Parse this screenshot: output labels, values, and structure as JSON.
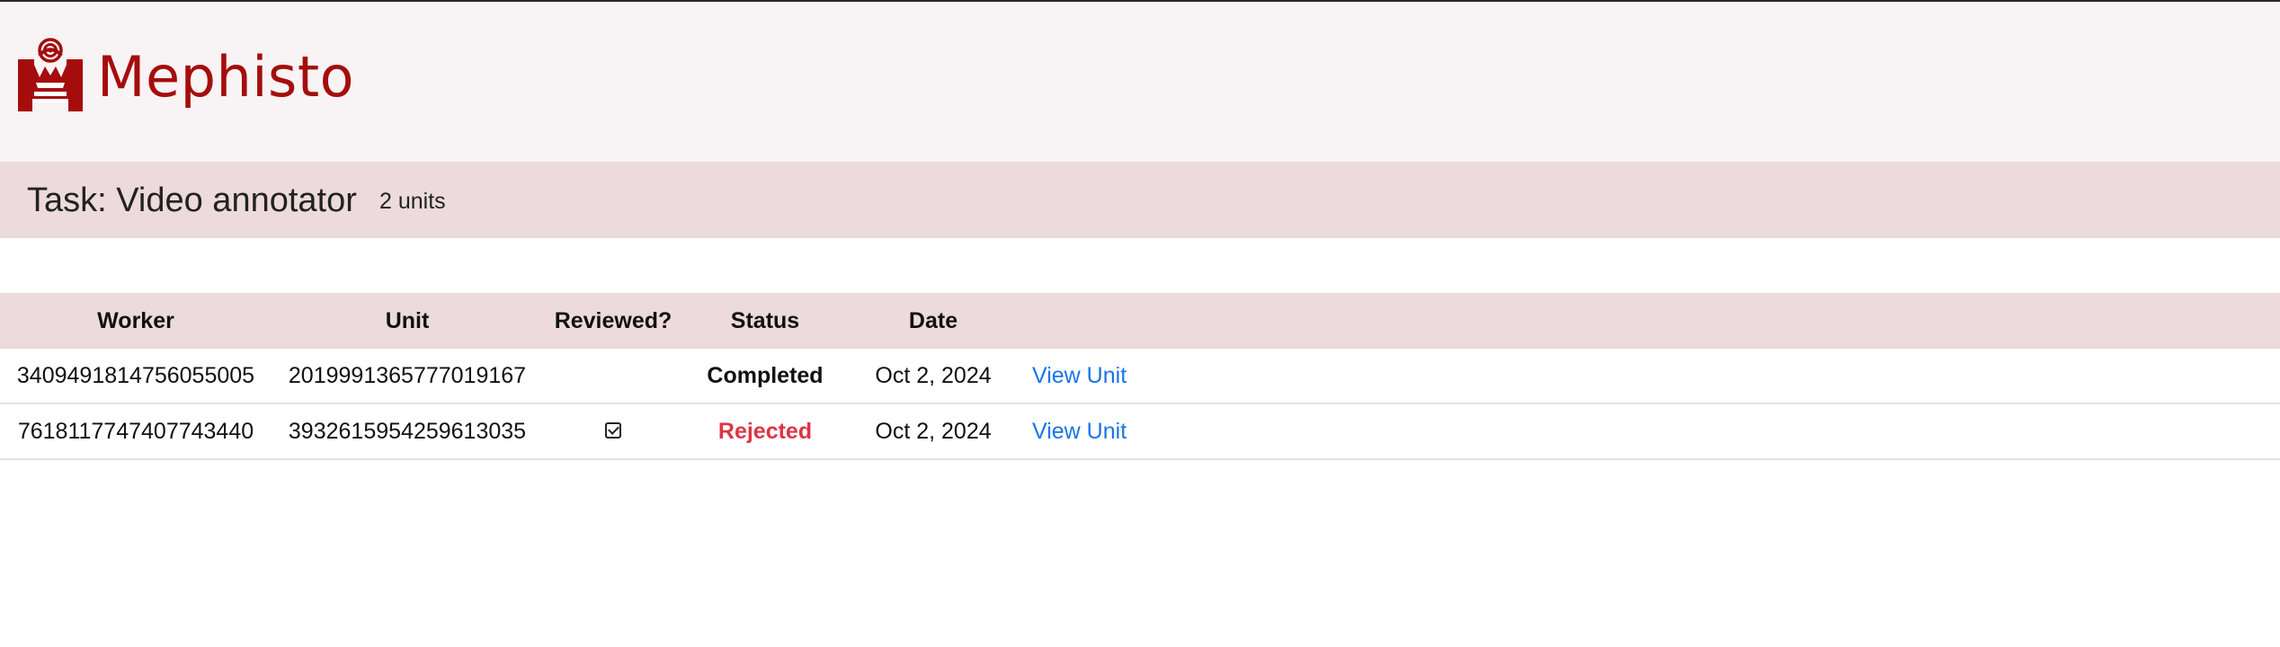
{
  "app": {
    "name": "Mephisto",
    "brand_color": "#a50d0d",
    "logo_icon": "crown-broadcast-logo-icon"
  },
  "task": {
    "title": "Task: Video annotator",
    "unit_count": "2 units"
  },
  "table": {
    "headers": {
      "worker": "Worker",
      "unit": "Unit",
      "reviewed": "Reviewed?",
      "status": "Status",
      "date": "Date"
    },
    "rows": [
      {
        "worker": "3409491814756055005",
        "unit": "2019991365777019167",
        "reviewed": false,
        "status": "Completed",
        "date": "Oct 2, 2024",
        "link": "View Unit"
      },
      {
        "worker": "7618117747407743440",
        "unit": "3932615954259613035",
        "reviewed": true,
        "reviewed_icon": "checkbox-checked-icon",
        "status": "Rejected",
        "date": "Oct 2, 2024",
        "link": "View Unit"
      }
    ]
  },
  "colors": {
    "header_bg": "#f8f3f4",
    "bar_bg": "#ecdadd",
    "rejected": "#dc3545",
    "link": "#1a73e8"
  }
}
